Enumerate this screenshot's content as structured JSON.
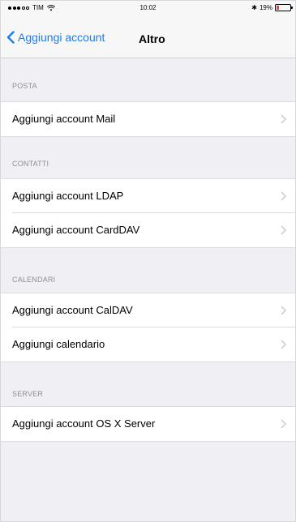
{
  "status_bar": {
    "carrier": "TIM",
    "time": "10:02",
    "battery_percent": "19%",
    "battery_level": 0.19
  },
  "nav": {
    "back_label": "Aggiungi account",
    "title": "Altro"
  },
  "sections": [
    {
      "header": "POSTA",
      "items": [
        "Aggiungi account Mail"
      ]
    },
    {
      "header": "CONTATTI",
      "items": [
        "Aggiungi account LDAP",
        "Aggiungi account CardDAV"
      ]
    },
    {
      "header": "CALENDARI",
      "items": [
        "Aggiungi account CalDAV",
        "Aggiungi calendario"
      ]
    },
    {
      "header": "SERVER",
      "items": [
        "Aggiungi account OS X Server"
      ]
    }
  ],
  "colors": {
    "accent": "#1a7cf5",
    "background": "#efeff4",
    "battery_low": "#ff3b30"
  }
}
